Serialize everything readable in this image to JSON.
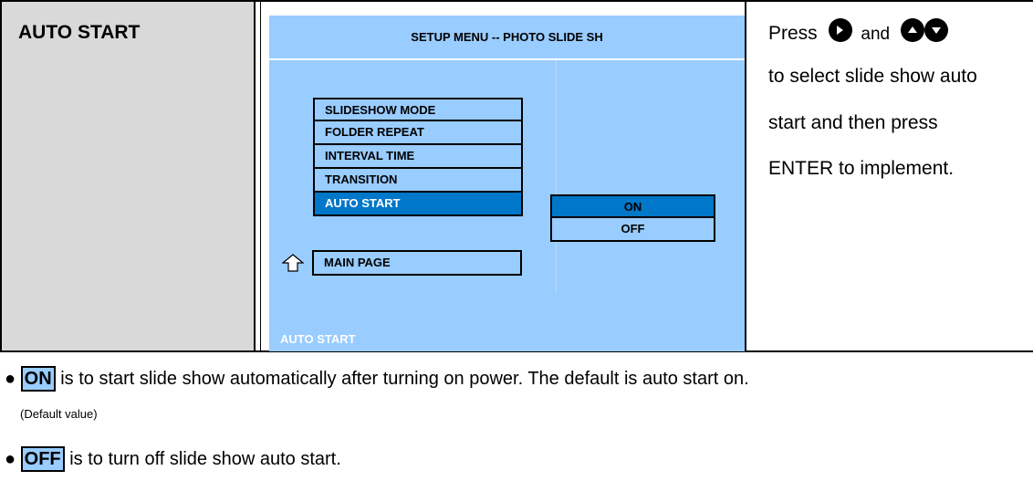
{
  "left": {
    "title": "AUTO START"
  },
  "screen": {
    "title": "SETUP MENU -- PHOTO SLIDE SH",
    "menu_items": [
      "SLIDESHOW MODE",
      "FOLDER REPEAT",
      "INTERVAL TIME",
      "TRANSITION",
      "AUTO START"
    ],
    "options": [
      "ON",
      "OFF"
    ],
    "main_page": "MAIN PAGE",
    "footer": "AUTO START"
  },
  "instructions": {
    "press": "Press",
    "and": "and",
    "line2": "to select slide show auto",
    "line3": "start and then press",
    "line4": "ENTER to implement."
  },
  "notes": {
    "on_word": "ON",
    "on_text": "is to start slide show automatically after turning on power. The default is auto start on.",
    "default_value": "(Default value)",
    "off_word": "OFF",
    "off_text": "is to turn off slide show auto start.",
    "bullet": "●"
  },
  "colors": {
    "screen_bg": "#99ccff",
    "selected_bg": "#0077c8",
    "left_cell_bg": "#d9d9d9"
  }
}
